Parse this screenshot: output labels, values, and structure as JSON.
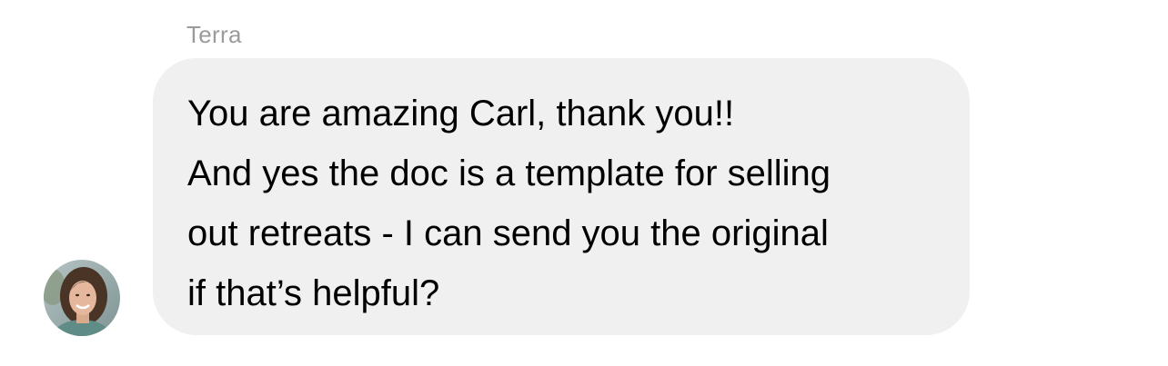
{
  "message": {
    "sender_name": "Terra",
    "lines": [
      "You are amazing Carl, thank you!!",
      "And yes the doc is a template for selling",
      "out retreats - I can send you the original",
      "if that’s helpful?"
    ],
    "bubble_color": "#f0f0f0",
    "sender_name_color": "#9b9b9b",
    "text_color": "#000000"
  },
  "avatar": {
    "icon": "user-photo-avatar"
  }
}
